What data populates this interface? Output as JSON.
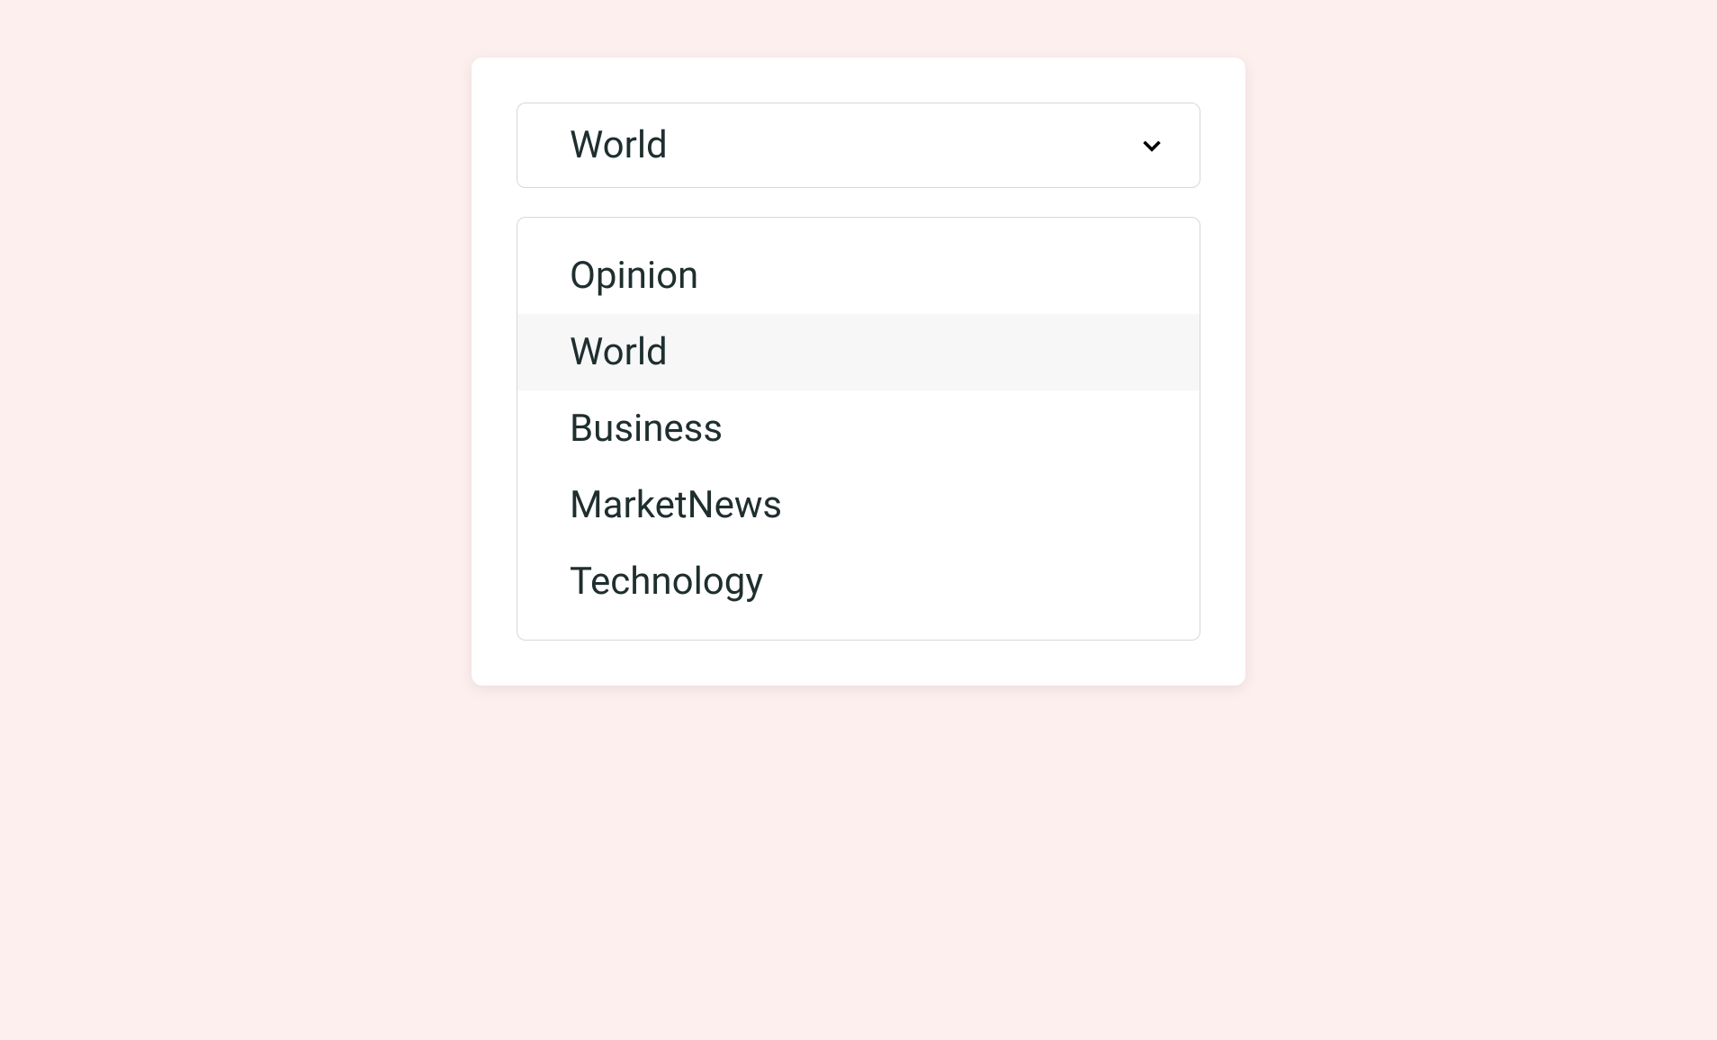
{
  "dropdown": {
    "selected": "World",
    "options": [
      {
        "label": "Opinion"
      },
      {
        "label": "World"
      },
      {
        "label": "Business"
      },
      {
        "label": "MarketNews"
      },
      {
        "label": "Technology"
      }
    ]
  }
}
